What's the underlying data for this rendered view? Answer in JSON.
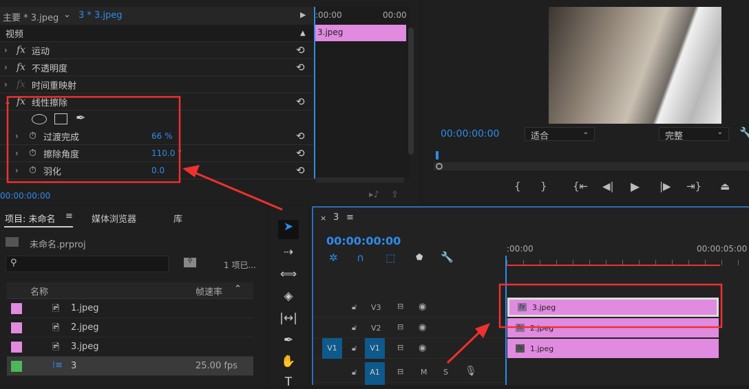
{
  "effect_controls": {
    "tab_master": "主要 * 3.jpeg",
    "tab_seq": "3 * 3.jpeg",
    "section": "视频",
    "effects": [
      {
        "name": "运动"
      },
      {
        "name": "不透明度"
      },
      {
        "name": "时间重映射"
      },
      {
        "name": "线性擦除"
      }
    ],
    "params": [
      {
        "name": "过渡完成",
        "value": "66 %"
      },
      {
        "name": "擦除角度",
        "value": "110.0 °"
      },
      {
        "name": "羽化",
        "value": "0.0"
      }
    ],
    "timecode": "00:00:00:00",
    "mini_start": ":00:00",
    "mini_end": "00:00",
    "mini_clip": "3.jpeg"
  },
  "program": {
    "timecode": "00:00:00:00",
    "fit": "适合",
    "quality": "完整"
  },
  "project": {
    "tabs": [
      "项目: 未命名",
      "媒体浏览器",
      "库"
    ],
    "file": "未命名.prproj",
    "count": "1 项已...",
    "col_name": "名称",
    "col_fps": "帧速率",
    "items": [
      {
        "name": "1.jpeg",
        "fps": "",
        "color": "#e08be0"
      },
      {
        "name": "2.jpeg",
        "fps": "",
        "color": "#e08be0"
      },
      {
        "name": "3.jpeg",
        "fps": "",
        "color": "#e08be0"
      },
      {
        "name": "3",
        "fps": "25.00 fps",
        "color": "#4cb85a"
      }
    ]
  },
  "timeline": {
    "tab": "3",
    "timecode": "00:00:00:00",
    "ruler_start": ":00:00",
    "ruler_end": "00:00:05:00",
    "tracks": [
      "V3",
      "V2",
      "V1",
      "A1"
    ],
    "src_v1": "V1",
    "m": "M",
    "s": "S",
    "clips": [
      "3.jpeg",
      "2.jpeg",
      "1.jpeg"
    ]
  },
  "colors": {
    "accent": "#2d8ceb",
    "clip": "#e08be0",
    "annotation": "#f03030"
  }
}
